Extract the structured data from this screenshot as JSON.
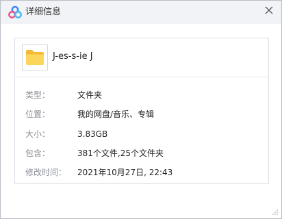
{
  "window": {
    "title": "详细信息",
    "app_icon": "baidu-netdisk-cloud-icon",
    "close_icon": "close-icon"
  },
  "file": {
    "icon": "folder-icon",
    "name": "J-es-s-ie J"
  },
  "details": [
    {
      "label": "类型：",
      "value": "文件夹"
    },
    {
      "label": "位置：",
      "value": "我的网盘/音乐、专辑"
    },
    {
      "label": "大小：",
      "value": "3.83GB"
    },
    {
      "label": "包含：",
      "value": "381个文件,25个文件夹"
    },
    {
      "label": "修改时间：",
      "value": "2021年10月27日, 22:43"
    }
  ],
  "colors": {
    "titlebar_bg": "#f1f3f6",
    "folder_yellow": "#f8c948",
    "label_gray": "#8a8f96",
    "brand_blue": "#3c8df0"
  }
}
